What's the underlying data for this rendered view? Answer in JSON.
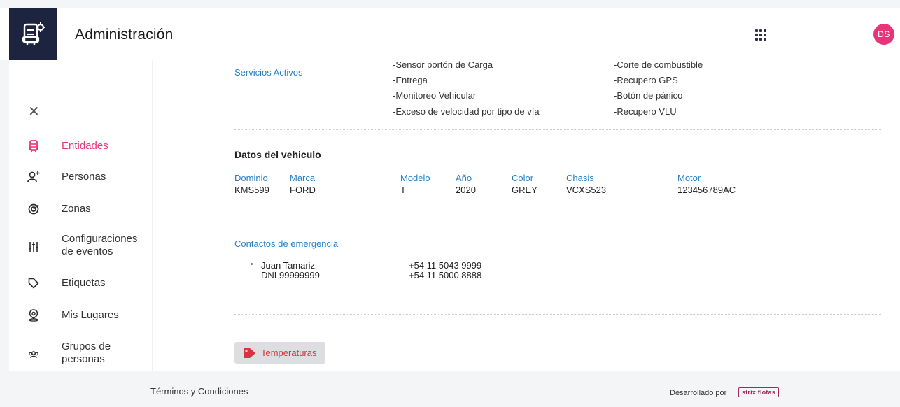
{
  "header": {
    "title": "Administración",
    "user_initials": "DS"
  },
  "sidebar": {
    "items": [
      {
        "label": "Entidades",
        "icon": "vehicle-icon",
        "active": true
      },
      {
        "label": "Personas",
        "icon": "person-add-icon",
        "active": false
      },
      {
        "label": "Zonas",
        "icon": "target-icon",
        "active": false
      },
      {
        "label": "Configuraciones de eventos",
        "icon": "sliders-icon",
        "active": false
      },
      {
        "label": "Etiquetas",
        "icon": "tag-icon",
        "active": false
      },
      {
        "label": "Mis Lugares",
        "icon": "location-pin-icon",
        "active": false
      },
      {
        "label": "Grupos de personas",
        "icon": "group-icon",
        "active": false
      }
    ]
  },
  "services": {
    "label": "Servicios Activos",
    "col1": [
      "-Sensor portón de Carga",
      "-Entrega",
      "-Monitoreo Vehicular",
      "-Exceso de velocidad por tipo de vía"
    ],
    "col2": [
      "-Corte de combustible",
      "-Recupero GPS",
      "-Botón de pánico",
      "-Recupero VLU"
    ]
  },
  "vehicle": {
    "title": "Datos del vehiculo",
    "columns": [
      {
        "header": "Dominio",
        "value": "KMS599"
      },
      {
        "header": "Marca",
        "value": "FORD"
      },
      {
        "header": "Modelo",
        "value": "T"
      },
      {
        "header": "Año",
        "value": "2020"
      },
      {
        "header": "Color",
        "value": "GREY"
      },
      {
        "header": "Chasis",
        "value": "VCXS523"
      },
      {
        "header": "Motor",
        "value": "123456789AC"
      }
    ]
  },
  "contacts": {
    "title": "Contactos de emergencia",
    "items": [
      {
        "name": "Juan Tamariz",
        "dni": "DNI 99999999",
        "phone1": "+54 11 5043 9999",
        "phone2": "+54 11 5000 8888"
      }
    ]
  },
  "tags": [
    {
      "label": "Temperaturas",
      "color": "#d9333f"
    }
  ],
  "footer": {
    "terms": "Términos y Condiciones",
    "developed_by": "Desarrollado por",
    "brand": "strix flotas"
  },
  "colors": {
    "accent": "#e8357a",
    "link": "#2a7fc4",
    "header_dark": "#1d2440"
  }
}
